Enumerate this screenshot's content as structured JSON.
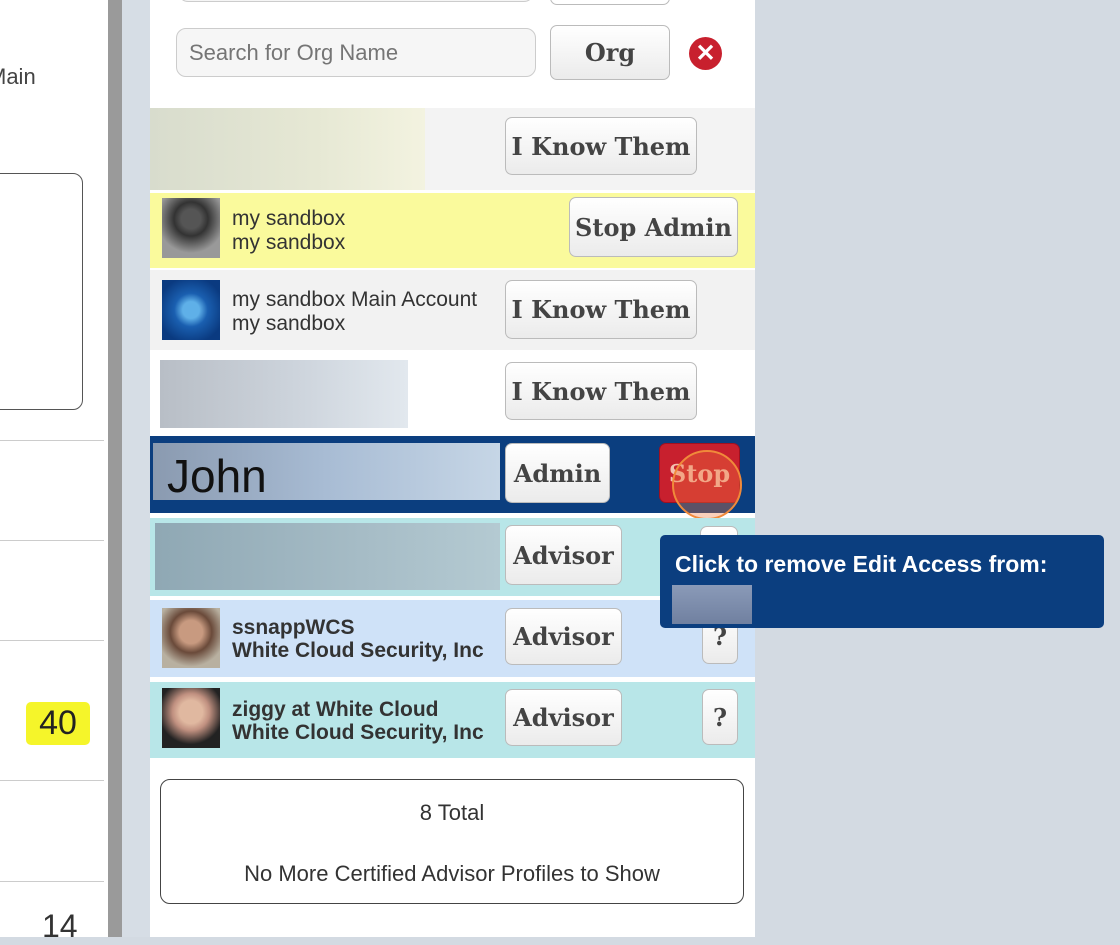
{
  "left": {
    "partial_text": "Main",
    "badge": "40",
    "bottom_number": "14"
  },
  "search": {
    "placeholder": "Search for Org Name",
    "org_button": "Org",
    "clear_icon": "red-x-circle-icon"
  },
  "rows": [
    {
      "button": "I Know Them"
    },
    {
      "name": "my sandbox",
      "org": "my sandbox",
      "button": "Stop Admin"
    },
    {
      "name": "my sandbox Main Account",
      "org": "my sandbox",
      "button": "I Know Them"
    },
    {
      "button": "I Know Them"
    },
    {
      "name": "John",
      "button": "Admin",
      "stop": "Stop"
    },
    {
      "button": "Advisor"
    },
    {
      "name": "ssnappWCS",
      "org": "White Cloud Security, Inc",
      "button": "Advisor",
      "help": "?"
    },
    {
      "name": "ziggy at White Cloud",
      "org": "White Cloud Security, Inc",
      "button": "Advisor",
      "help": "?"
    }
  ],
  "tooltip": {
    "text": "Click to remove Edit Access from:"
  },
  "footer": {
    "total": "8 Total",
    "message": "No More Certified Advisor Profiles to Show"
  },
  "colors": {
    "selected_row": "#0b3e7f",
    "admin_row": "#fafa9c",
    "advisor_row": "#b8e6e8",
    "advisor_row_alt": "#cfe2f8",
    "stop": "#c8202e",
    "badge": "#f5f52a"
  }
}
